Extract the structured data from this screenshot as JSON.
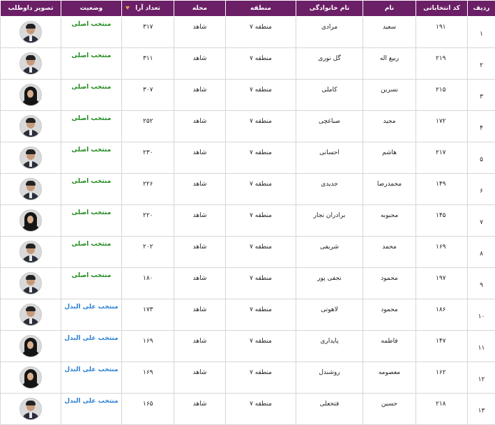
{
  "table": {
    "headers": {
      "row_no": "ردیف",
      "code": "کد انتخاباتی",
      "first_name": "نام",
      "last_name": "نام خانوادگی",
      "region": "منطقه",
      "area": "محله",
      "votes": "تعداد آرا",
      "status": "وضعیت",
      "photo": "تصویر داوطلب"
    },
    "colors": {
      "header_bg": "#6b1f66",
      "status_main": "#1e8a1e",
      "status_alt": "#2a7fd4",
      "sort_arrow": "#e8a93b"
    },
    "rows": [
      {
        "row_no": "۱",
        "code": "۱۹۱",
        "first_name": "سعید",
        "last_name": "مرادی",
        "region": "منطقه ۷",
        "area": "شاهد",
        "votes": "۳۱۷",
        "status": "منتخب اصلی",
        "status_type": "main",
        "photo": "male-candidate-photo"
      },
      {
        "row_no": "۲",
        "code": "۲۱۹",
        "first_name": "ربیع اله",
        "last_name": "گل نوری",
        "region": "منطقه ۷",
        "area": "شاهد",
        "votes": "۳۱۱",
        "status": "منتخب اصلی",
        "status_type": "main",
        "photo": "male-candidate-photo"
      },
      {
        "row_no": "۳",
        "code": "۲۱۵",
        "first_name": "نسرین",
        "last_name": "کاملی",
        "region": "منطقه ۷",
        "area": "شاهد",
        "votes": "۳۰۷",
        "status": "منتخب اصلی",
        "status_type": "main",
        "photo": "female-candidate-photo"
      },
      {
        "row_no": "۴",
        "code": "۱۷۲",
        "first_name": "مجید",
        "last_name": "صباغچی",
        "region": "منطقه ۷",
        "area": "شاهد",
        "votes": "۲۵۲",
        "status": "منتخب اصلی",
        "status_type": "main",
        "photo": "male-candidate-photo"
      },
      {
        "row_no": "۵",
        "code": "۲۱۷",
        "first_name": "هاشم",
        "last_name": "احسانی",
        "region": "منطقه ۷",
        "area": "شاهد",
        "votes": "۲۳۰",
        "status": "منتخب اصلی",
        "status_type": "main",
        "photo": "male-candidate-photo"
      },
      {
        "row_no": "۶",
        "code": "۱۴۹",
        "first_name": "محمدرضا",
        "last_name": "جدیدی",
        "region": "منطقه ۷",
        "area": "شاهد",
        "votes": "۲۲۶",
        "status": "منتخب اصلی",
        "status_type": "main",
        "photo": "male-candidate-photo"
      },
      {
        "row_no": "۷",
        "code": "۱۴۵",
        "first_name": "محبوبه",
        "last_name": "برادران نجار",
        "region": "منطقه ۷",
        "area": "شاهد",
        "votes": "۲۲۰",
        "status": "منتخب اصلی",
        "status_type": "main",
        "photo": "female-candidate-photo"
      },
      {
        "row_no": "۸",
        "code": "۱۶۹",
        "first_name": "محمد",
        "last_name": "شریفی",
        "region": "منطقه ۷",
        "area": "شاهد",
        "votes": "۲۰۲",
        "status": "منتخب اصلی",
        "status_type": "main",
        "photo": "male-candidate-photo"
      },
      {
        "row_no": "۹",
        "code": "۱۹۷",
        "first_name": "محمود",
        "last_name": "نجفی پور",
        "region": "منطقه ۷",
        "area": "شاهد",
        "votes": "۱۸۰",
        "status": "منتخب اصلی",
        "status_type": "main",
        "photo": "male-candidate-photo"
      },
      {
        "row_no": "۱۰",
        "code": "۱۸۶",
        "first_name": "محمود",
        "last_name": "لاهوتی",
        "region": "منطقه ۷",
        "area": "شاهد",
        "votes": "۱۷۳",
        "status": "منتخب علی البدل",
        "status_type": "alt",
        "photo": "male-candidate-photo"
      },
      {
        "row_no": "۱۱",
        "code": "۱۴۷",
        "first_name": "فاطمه",
        "last_name": "پایداری",
        "region": "منطقه ۷",
        "area": "شاهد",
        "votes": "۱۶۹",
        "status": "منتخب علی البدل",
        "status_type": "alt",
        "photo": "female-candidate-photo"
      },
      {
        "row_no": "۱۲",
        "code": "۱۶۲",
        "first_name": "معصومه",
        "last_name": "روشندل",
        "region": "منطقه ۷",
        "area": "شاهد",
        "votes": "۱۶۹",
        "status": "منتخب علی البدل",
        "status_type": "alt",
        "photo": "female-candidate-photo"
      },
      {
        "row_no": "۱۳",
        "code": "۲۱۸",
        "first_name": "حسین",
        "last_name": "فتحعلی",
        "region": "منطقه ۷",
        "area": "شاهد",
        "votes": "۱۶۵",
        "status": "منتخب علی البدل",
        "status_type": "alt",
        "photo": "male-candidate-photo"
      }
    ]
  }
}
